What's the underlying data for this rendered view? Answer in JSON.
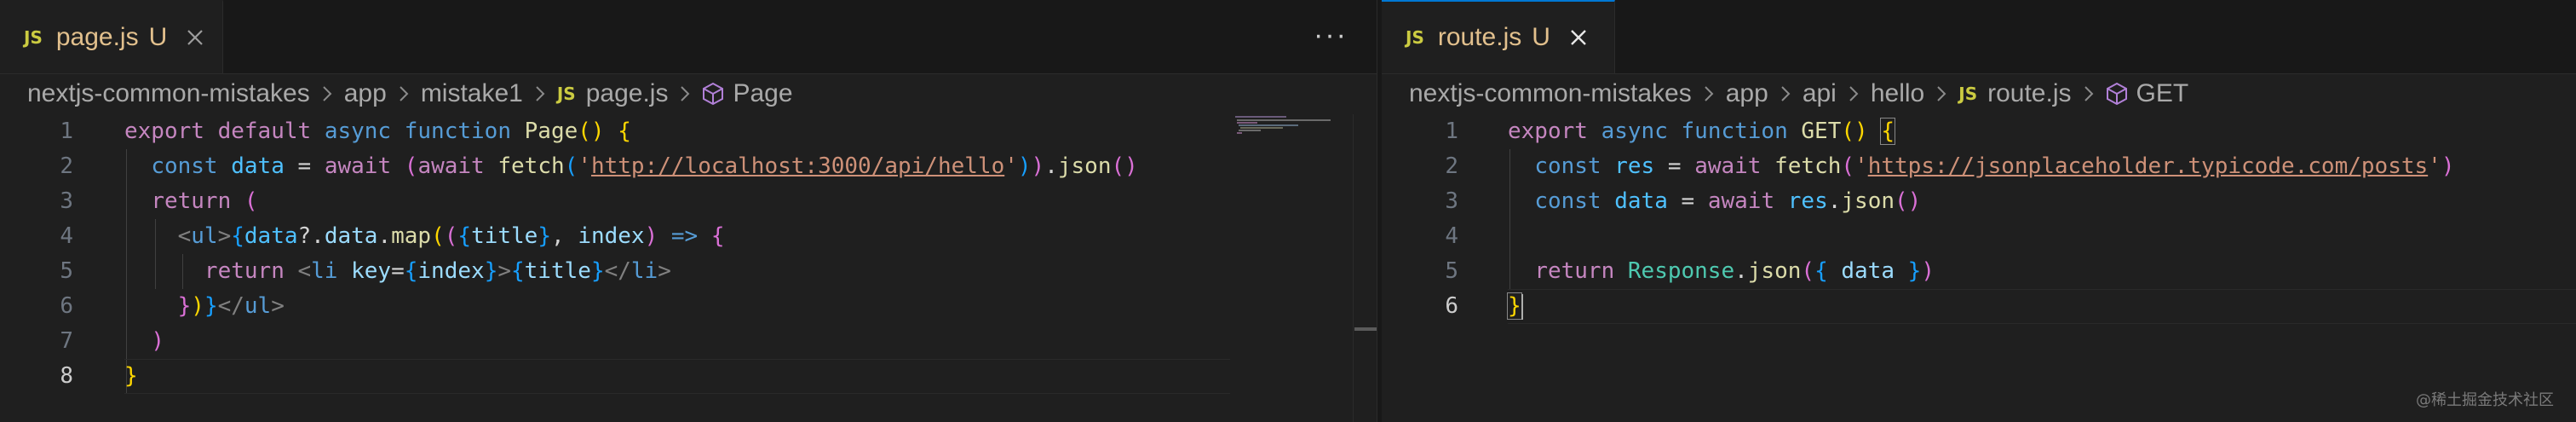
{
  "colors": {
    "background": "#1f1f1f",
    "tab_modified": "#e2c08d",
    "active_tab_accent": "#0078d4",
    "keyword": "#c586c0",
    "storage": "#569cd6",
    "function": "#dcdcaa",
    "variable": "#9cdcfe",
    "string": "#ce9178"
  },
  "left": {
    "tab": {
      "badge": "JS",
      "name": "page.js",
      "status": "U",
      "close_icon": "close-icon"
    },
    "more_actions": "···",
    "breadcrumb": {
      "items": [
        "nextjs-common-mistakes",
        "app",
        "mistake1"
      ],
      "file": "page.js",
      "file_badge": "JS",
      "symbol": "Page",
      "separator_icon": "chevron-right-icon",
      "symbol_icon": "symbol-method-icon"
    },
    "line_numbers": [
      "1",
      "2",
      "3",
      "4",
      "5",
      "6",
      "7",
      "8"
    ],
    "active_line": "8",
    "code": {
      "l1": {
        "export": "export",
        "default": "default",
        "async": "async",
        "function": "function",
        "name": "Page",
        "paren": "()",
        "brace": "{"
      },
      "l2": {
        "const": "const",
        "var": "data",
        "eq": "=",
        "await1": "await",
        "open_outer": "(",
        "await2": "await",
        "fetch": "fetch",
        "open_inner": "(",
        "quote_open": "'",
        "url": "http://localhost:3000/api/hello",
        "quote_close": "'",
        "close_inner": ")",
        "close_outer": ")",
        "dot": ".",
        "json": "json",
        "call": "()"
      },
      "l3": {
        "return": "return",
        "paren": "("
      },
      "l4": {
        "lt": "<",
        "tag": "ul",
        "gt": ">",
        "brace": "{",
        "obj": "data",
        "optional": "?.",
        "prop": "data",
        "dot": ".",
        "map": "map",
        "p1": "(",
        "p2": "(",
        "b3": "{",
        "title": "title",
        "b3c": "}",
        "comma": ",",
        "index": "index",
        "p2c": ")",
        "arrow": "=>",
        "body": "{"
      },
      "l5": {
        "return": "return",
        "lt": "<",
        "tag": "li",
        "attr": "key",
        "eq": "=",
        "b1": "{",
        "index": "index",
        "b1c": "}",
        "gt": ">",
        "b2": "{",
        "title": "title",
        "b2c": "}",
        "close_lt": "</",
        "close_tag": "li",
        "close_gt": ">"
      },
      "l6": {
        "body_close": "}",
        "call_close": ")",
        "brace_close": "}",
        "close_lt": "</",
        "close_tag": "ul",
        "close_gt": ">"
      },
      "l7": {
        "paren_close": ")"
      },
      "l8": {
        "brace_close": "}"
      }
    }
  },
  "right": {
    "tab": {
      "badge": "JS",
      "name": "route.js",
      "status": "U",
      "close_icon": "close-icon"
    },
    "breadcrumb": {
      "items": [
        "nextjs-common-mistakes",
        "app",
        "api",
        "hello"
      ],
      "file": "route.js",
      "file_badge": "JS",
      "symbol": "GET",
      "separator_icon": "chevron-right-icon",
      "symbol_icon": "symbol-method-icon"
    },
    "line_numbers": [
      "1",
      "2",
      "3",
      "4",
      "5",
      "6"
    ],
    "active_line": "6",
    "code": {
      "l1": {
        "export": "export",
        "async": "async",
        "function": "function",
        "name": "GET",
        "paren": "()",
        "brace": "{"
      },
      "l2": {
        "const": "const",
        "var": "res",
        "eq": "=",
        "await": "await",
        "fetch": "fetch",
        "open": "(",
        "quote_open": "'",
        "url": "https://jsonplaceholder.typicode.com/posts",
        "quote_close": "'",
        "close": ")"
      },
      "l3": {
        "const": "const",
        "var": "data",
        "eq": "=",
        "await": "await",
        "obj": "res",
        "dot": ".",
        "json": "json",
        "call": "()"
      },
      "l5": {
        "return": "return",
        "cls": "Response",
        "dot": ".",
        "json": "json",
        "open": "(",
        "b2": "{",
        "data": "data",
        "b2c": "}",
        "close": ")"
      },
      "l6": {
        "brace_close": "}"
      }
    }
  },
  "watermark": "@稀土掘金技术社区"
}
